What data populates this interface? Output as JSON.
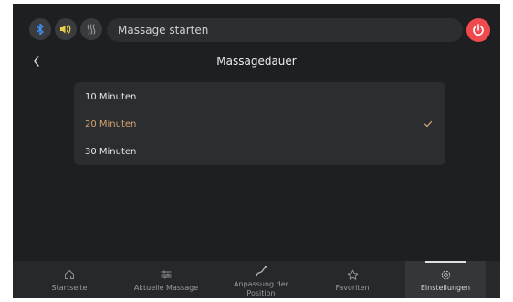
{
  "header": {
    "status_icons": [
      "bluetooth-icon",
      "speaker-icon",
      "heat-icon"
    ],
    "start_label": "Massage starten",
    "power_icon": "power-icon"
  },
  "page": {
    "title": "Massagedauer",
    "back_icon": "chevron-left-icon"
  },
  "duration_options": [
    {
      "label": "10 Minuten",
      "selected": false
    },
    {
      "label": "20 Minuten",
      "selected": true
    },
    {
      "label": "30 Minuten",
      "selected": false
    }
  ],
  "nav": {
    "items": [
      {
        "label": "Startseite",
        "icon": "home-icon"
      },
      {
        "label": "Aktuelle Massage",
        "icon": "sliders-icon"
      },
      {
        "label": "Anpassung der Position",
        "icon": "recline-icon"
      },
      {
        "label": "Favoriten",
        "icon": "star-icon"
      },
      {
        "label": "Einstellungen",
        "icon": "gear-icon"
      }
    ],
    "active": "Einstellungen"
  },
  "colors": {
    "background": "#1e1f21",
    "accent": "#d7a36e",
    "bluetooth": "#3d8ff2",
    "heat": "#9b9b9b",
    "power": "#f04a4f"
  }
}
